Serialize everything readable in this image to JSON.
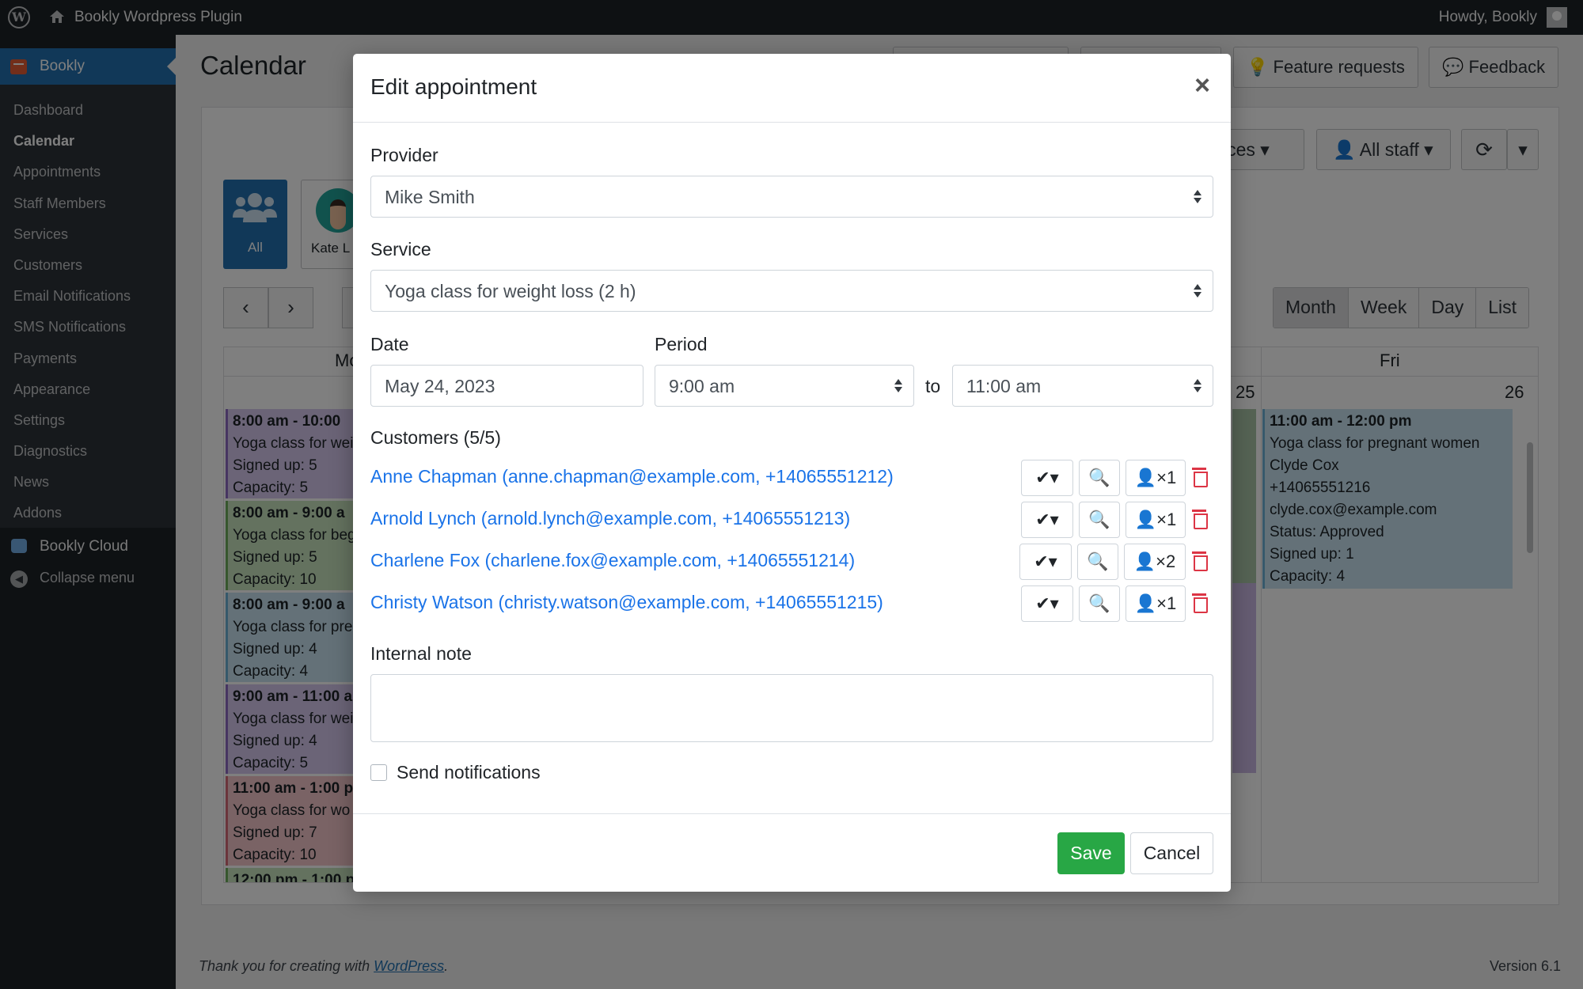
{
  "adminbar": {
    "site_name": "Bookly Wordpress Plugin",
    "howdy": "Howdy, Bookly"
  },
  "sidebar": {
    "top_label": "Bookly",
    "items": [
      {
        "label": "Dashboard"
      },
      {
        "label": "Calendar"
      },
      {
        "label": "Appointments"
      },
      {
        "label": "Staff Members"
      },
      {
        "label": "Services"
      },
      {
        "label": "Customers"
      },
      {
        "label": "Email Notifications"
      },
      {
        "label": "SMS Notifications"
      },
      {
        "label": "Payments"
      },
      {
        "label": "Appearance"
      },
      {
        "label": "Settings"
      },
      {
        "label": "Diagnostics"
      },
      {
        "label": "News"
      },
      {
        "label": "Addons"
      }
    ],
    "current": "Calendar",
    "cloud_label": "Bookly Cloud",
    "collapse_label": "Collapse menu"
  },
  "page": {
    "title": "Calendar",
    "feature_requests": "Feature requests",
    "feedback": "Feedback",
    "services_filter": "ices",
    "staff_filter": "All staff",
    "staff_all": "All",
    "staff_kate": "Kate L",
    "views": [
      "Month",
      "Week",
      "Day",
      "List"
    ],
    "day_headers": {
      "mon": "Mo",
      "fri": "Fri"
    },
    "day_nums": {
      "thu": "25",
      "fri": "26"
    }
  },
  "events": {
    "mon": [
      {
        "time": "8:00 am - 10:00",
        "service": "Yoga class for wei",
        "signed": "Signed up: 5",
        "capacity": "Capacity: 5",
        "color": "#b49bd9"
      },
      {
        "time": "8:00 am - 9:00 a",
        "service": "Yoga class for beg",
        "signed": "Signed up: 5",
        "capacity": "Capacity: 10",
        "color": "#9ccc8e"
      },
      {
        "time": "8:00 am - 9:00 a",
        "service": "Yoga class for pre",
        "signed": "Signed up: 4",
        "capacity": "Capacity: 4",
        "color": "#9dcde6"
      },
      {
        "time": "9:00 am - 11:00 a",
        "service": "Yoga class for wei",
        "signed": "Signed up: 4",
        "capacity": "Capacity: 5",
        "color": "#b49bd9"
      },
      {
        "time": "11:00 am - 1:00 p",
        "service": "Yoga class for wo",
        "signed": "Signed up: 7",
        "capacity": "Capacity: 10",
        "color": "#ec9aa2"
      },
      {
        "time": "12:00 pm - 1:00 p",
        "service": "",
        "signed": "",
        "capacity": "",
        "color": "#9ccc8e"
      }
    ],
    "fri": {
      "time": "11:00 am - 12:00 pm",
      "service": "Yoga class for pregnant women",
      "customer": "Clyde Cox",
      "phone": "+14065551216",
      "email": "clyde.cox@example.com",
      "status": "Status: Approved",
      "signed": "Signed up: 1",
      "capacity": "Capacity: 4",
      "color": "#9dcde6"
    }
  },
  "modal": {
    "title": "Edit appointment",
    "provider_label": "Provider",
    "provider_value": "Mike Smith",
    "service_label": "Service",
    "service_value": "Yoga class for weight loss (2 h)",
    "date_label": "Date",
    "date_value": "May 24, 2023",
    "period_label": "Period",
    "period_from": "9:00 am",
    "to_label": "to",
    "period_to": "11:00 am",
    "customers_label": "Customers (5/5)",
    "customers": [
      {
        "text": "Anne Chapman (anne.chapman@example.com, +14065551212)",
        "count": "×1"
      },
      {
        "text": "Arnold Lynch (arnold.lynch@example.com, +14065551213)",
        "count": "×1"
      },
      {
        "text": "Charlene Fox (charlene.fox@example.com, +14065551214)",
        "count": "×2"
      },
      {
        "text": "Christy Watson (christy.watson@example.com, +14065551215)",
        "count": "×1"
      }
    ],
    "note_label": "Internal note",
    "note_value": "",
    "send_notifications_label": "Send notifications",
    "send_notifications_checked": false,
    "save_label": "Save",
    "cancel_label": "Cancel"
  },
  "footer": {
    "thanks_prefix": "Thank you for creating with",
    "link": "WordPress",
    "suffix": ".",
    "version": "Version 6.1"
  }
}
